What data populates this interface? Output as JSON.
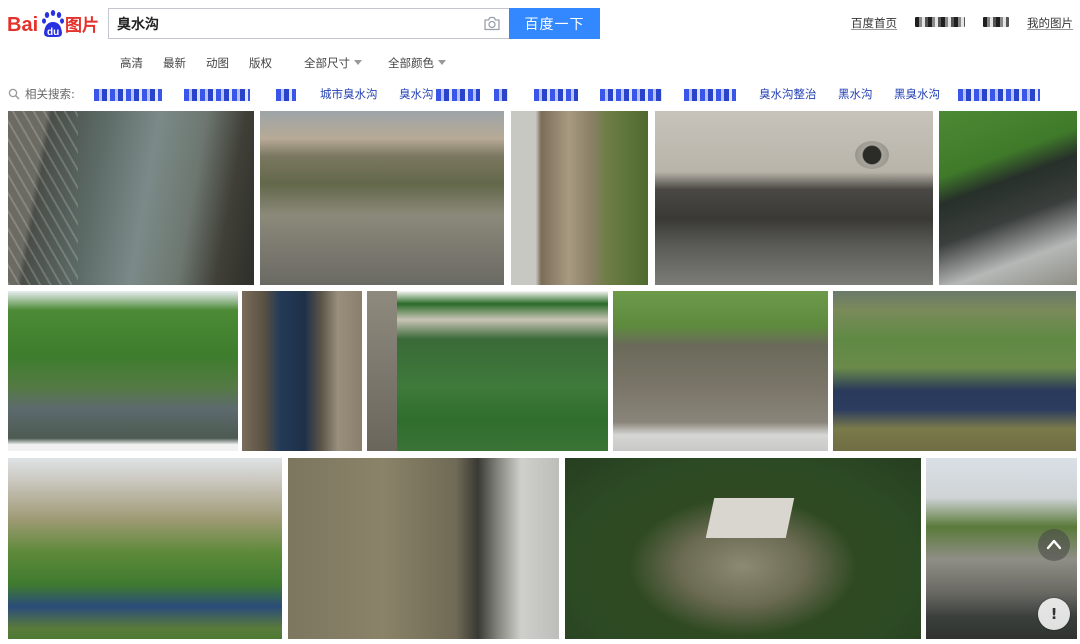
{
  "header": {
    "logo_text_1": "Bai",
    "logo_text_2": "du",
    "logo_text_3": "图片",
    "search_value": "臭水沟",
    "search_button": "百度一下",
    "camera_icon": "camera-icon",
    "links": {
      "home": "百度首页",
      "my_images": "我的图片"
    }
  },
  "filters": [
    {
      "label": "高清",
      "dropdown": false
    },
    {
      "label": "最新",
      "dropdown": false
    },
    {
      "label": "动图",
      "dropdown": false
    },
    {
      "label": "版权",
      "dropdown": false
    },
    {
      "label": "全部尺寸",
      "dropdown": true
    },
    {
      "label": "全部颜色",
      "dropdown": true
    }
  ],
  "related": {
    "icon": "search-icon",
    "label": "相关搜索:",
    "items": [
      "城市臭水沟",
      "臭水沟",
      "臭水沟整治",
      "黑水沟",
      "黑臭水沟"
    ]
  },
  "colors": {
    "accent": "#3388ff",
    "link": "#2440b3",
    "logo_red": "#e4312b",
    "logo_blue": "#2932e1"
  },
  "buttons": {
    "scroll_top_icon": "chevron-up-icon",
    "feedback": "!"
  }
}
